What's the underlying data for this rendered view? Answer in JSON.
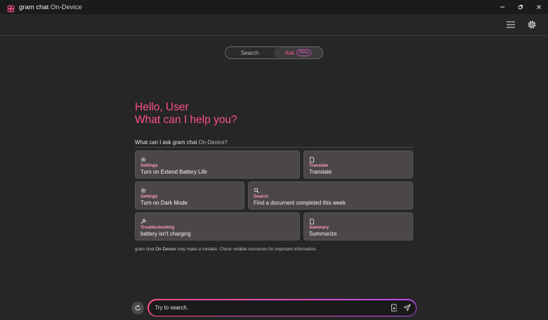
{
  "window": {
    "title_main": "gram chat",
    "title_suffix": "On-Device",
    "icons": [
      "app-logo",
      "minimize-icon",
      "maximize-icon",
      "close-icon"
    ]
  },
  "toolbar": {
    "icons": [
      "menu-icon",
      "gear-icon"
    ]
  },
  "mode_toggle": {
    "search_label": "Search",
    "ask_label": "Ask",
    "beta_label": "Beta",
    "active": "Ask"
  },
  "greeting": {
    "line1": "Hello, User",
    "line2": "What can I help you?"
  },
  "suggestions": {
    "heading_prefix": "What can I ask gram chat ",
    "heading_suffix": "On-Device?",
    "cards": [
      {
        "category": "Settings",
        "label": "Turn on Extend Battery Life",
        "icon": "gear-icon"
      },
      {
        "category": "Translate",
        "label": "Translate",
        "icon": "document-icon"
      },
      {
        "category": "Settings",
        "label": "Turn on Dark Mode",
        "icon": "gear-icon"
      },
      {
        "category": "Search",
        "label": "Find a document completed this week",
        "icon": "search-icon"
      },
      {
        "category": "Troubleshooting",
        "label": "battery isn't charging",
        "icon": "wrench-icon"
      },
      {
        "category": "Summary",
        "label": "Summarize",
        "icon": "document-icon"
      }
    ]
  },
  "disclaimer": {
    "prefix": "gram chat ",
    "highlight": "On-Device",
    "suffix": " may make a mistake. Check reliable resources for important information."
  },
  "input": {
    "placeholder": "Try to search.",
    "icons": [
      "reset-icon",
      "attach-file-icon",
      "send-icon"
    ]
  },
  "colors": {
    "accent": "#ff4f86",
    "background": "#262626",
    "card": "#4b4747",
    "gradient_end": "#b94df0"
  }
}
